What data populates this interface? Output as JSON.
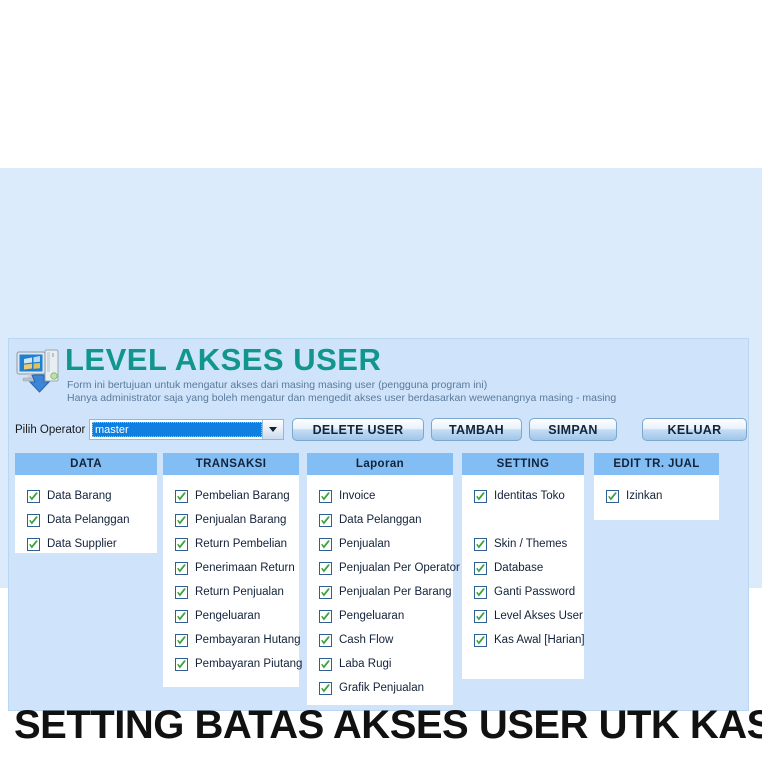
{
  "header": {
    "icon": "computer-download-icon",
    "title": "LEVEL AKSES USER",
    "subtitle_line1": "Form ini bertujuan untuk mengatur akses dari masing masing user (pengguna program ini)",
    "subtitle_line2": "Hanya administrator saja yang boleh mengatur dan mengedit akses user berdasarkan wewenangnya masing - masing",
    "accent_color": "#11968e"
  },
  "operator": {
    "label": "Pilih Operator :",
    "selected": "master",
    "dropdown_icon": "chevron-down-icon"
  },
  "buttons": {
    "delete": "DELETE USER",
    "tambah": "TAMBAH",
    "simpan": "SIMPAN",
    "keluar": "KELUAR"
  },
  "columns": [
    {
      "id": "data",
      "header": "DATA",
      "items": [
        {
          "label": "Data Barang",
          "checked": true
        },
        {
          "label": "Data Pelanggan",
          "checked": true
        },
        {
          "label": "Data Supplier",
          "checked": true
        }
      ]
    },
    {
      "id": "transaksi",
      "header": "TRANSAKSI",
      "items": [
        {
          "label": "Pembelian Barang",
          "checked": true
        },
        {
          "label": "Penjualan Barang",
          "checked": true
        },
        {
          "label": "Return Pembelian",
          "checked": true
        },
        {
          "label": "Penerimaan Return",
          "checked": true
        },
        {
          "label": "Return Penjualan",
          "checked": true
        },
        {
          "label": "Pengeluaran",
          "checked": true
        },
        {
          "label": "Pembayaran Hutang",
          "checked": true
        },
        {
          "label": "Pembayaran Piutang",
          "checked": true
        }
      ]
    },
    {
      "id": "laporan",
      "header": "Laporan",
      "items": [
        {
          "label": "Invoice",
          "checked": true
        },
        {
          "label": "Data Pelanggan",
          "checked": true
        },
        {
          "label": "Penjualan",
          "checked": true
        },
        {
          "label": "Penjualan Per Operator",
          "checked": true
        },
        {
          "label": "Penjualan Per Barang",
          "checked": true
        },
        {
          "label": "Pengeluaran",
          "checked": true
        },
        {
          "label": "Cash Flow",
          "checked": true
        },
        {
          "label": "Laba Rugi",
          "checked": true
        },
        {
          "label": "Grafik Penjualan",
          "checked": true
        }
      ]
    },
    {
      "id": "setting",
      "header": "SETTING",
      "items": [
        {
          "label": "Identitas Toko",
          "checked": true
        },
        {
          "label": "",
          "checked": null
        },
        {
          "label": "Skin / Themes",
          "checked": true
        },
        {
          "label": "Database",
          "checked": true
        },
        {
          "label": "Ganti Password",
          "checked": true
        },
        {
          "label": "Level Akses User",
          "checked": true
        },
        {
          "label": "Kas Awal [Harian]",
          "checked": true
        }
      ]
    },
    {
      "id": "edit-tr-jual",
      "header": "EDIT TR. JUAL",
      "items": [
        {
          "label": "Izinkan",
          "checked": true
        }
      ]
    }
  ],
  "caption": "SETTING BATAS AKSES USER UTK KASIR",
  "theme": {
    "band_background": "#dcebfb",
    "window_background": "#cfe3fa",
    "column_header_background": "#82bdf4",
    "panel_background": "#ffffff",
    "check_color": "#2f9133"
  }
}
